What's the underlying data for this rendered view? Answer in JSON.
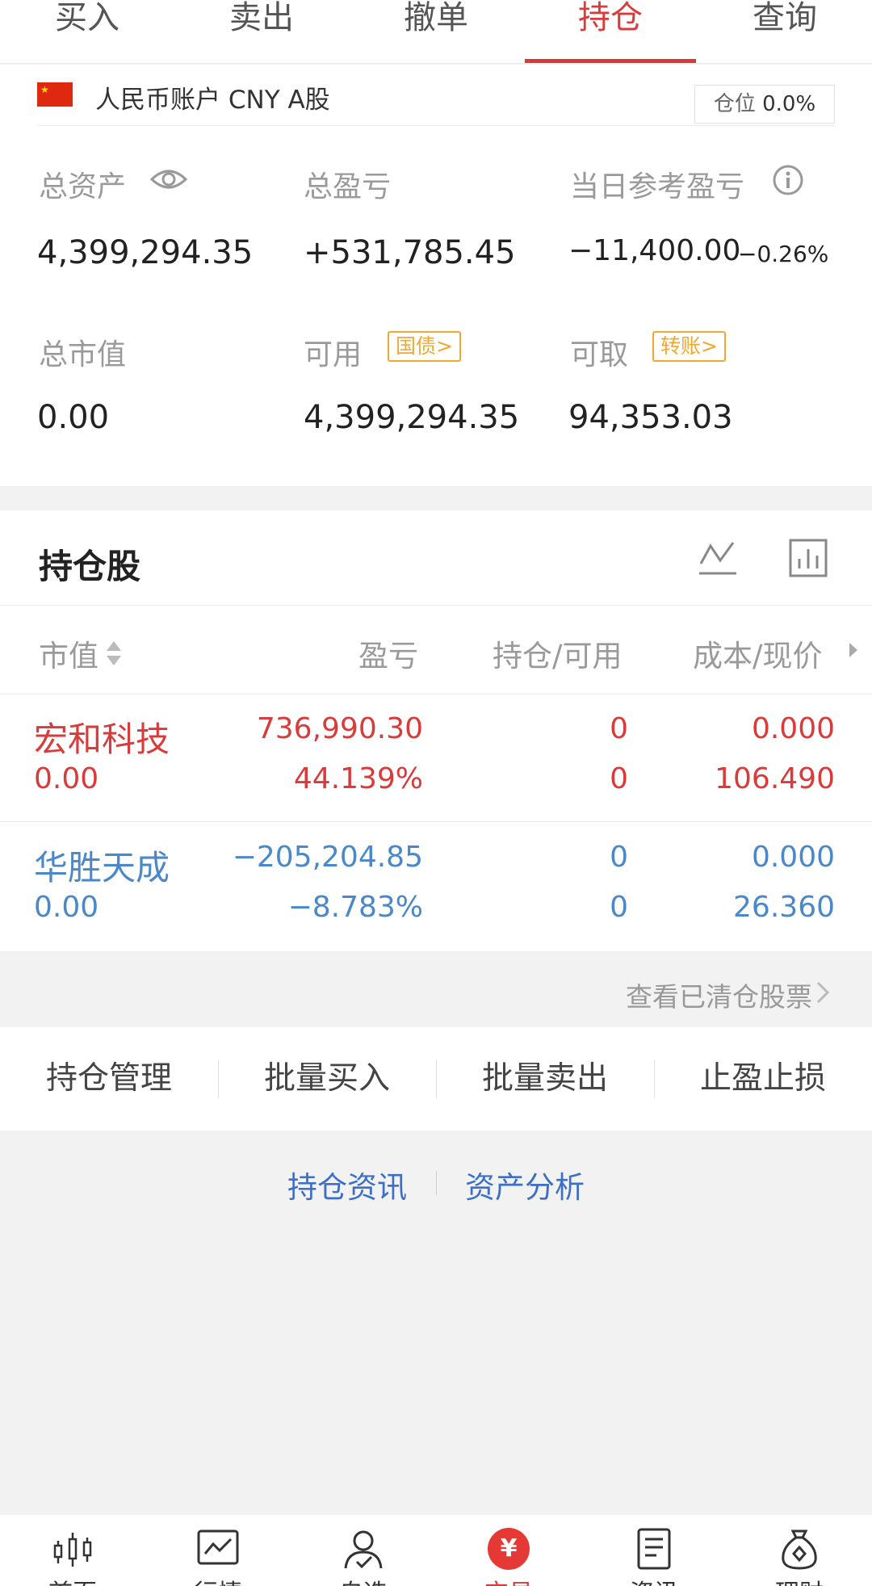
{
  "top_tabs": [
    "买入",
    "卖出",
    "撤单",
    "持仓",
    "查询"
  ],
  "account": {
    "name": "人民币账户 CNY A股",
    "position_label": "仓位",
    "position_value": "0.0%",
    "total_assets_label": "总资产",
    "total_assets": "4,399,294.35",
    "total_pnl_label": "总盈亏",
    "total_pnl": "+531,785.45",
    "today_pnl_label": "当日参考盈亏",
    "today_pnl": "−11,400.00",
    "today_pnl_pct": "−0.26%",
    "market_value_label": "总市值",
    "market_value": "0.00",
    "available_label": "可用",
    "available_tag": "国债>",
    "available": "4,399,294.35",
    "withdrawable_label": "可取",
    "withdrawable_tag": "转账>",
    "withdrawable": "94,353.03"
  },
  "holdings": {
    "title": "持仓股",
    "columns": [
      "市值",
      "盈亏",
      "持仓/可用",
      "成本/现价"
    ],
    "rows": [
      {
        "name": "宏和科技",
        "market_value": "0.00",
        "pnl": "736,990.30",
        "pnl_pct": "44.139%",
        "position": "0",
        "available": "0",
        "cost": "0.000",
        "price": "106.490",
        "color": "#d93a3a"
      },
      {
        "name": "华胜天成",
        "market_value": "0.00",
        "pnl": "−205,204.85",
        "pnl_pct": "−8.783%",
        "position": "0",
        "available": "0",
        "cost": "0.000",
        "price": "26.360",
        "color": "#4a88c8"
      }
    ],
    "history_link": "查看已清仓股票"
  },
  "actions": [
    "持仓管理",
    "批量买入",
    "批量卖出",
    "止盈止损"
  ],
  "links": [
    "持仓资讯",
    "资产分析"
  ],
  "bottom_nav": [
    "首页",
    "行情",
    "自选",
    "交易",
    "资讯",
    "理财"
  ]
}
